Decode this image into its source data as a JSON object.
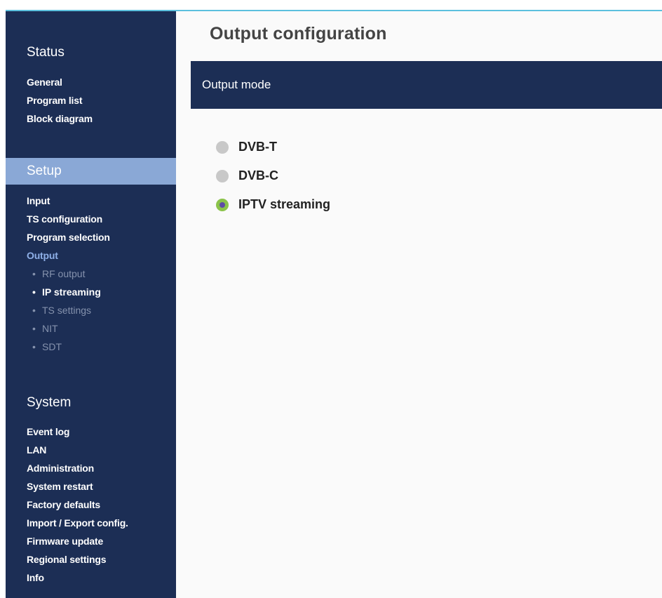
{
  "sidebar": {
    "status": {
      "title": "Status",
      "items": [
        "General",
        "Program list",
        "Block diagram"
      ]
    },
    "setup": {
      "title": "Setup",
      "items": [
        "Input",
        "TS configuration",
        "Program selection",
        "Output"
      ],
      "output_sub": [
        "RF output",
        "IP streaming",
        "TS settings",
        "NIT",
        "SDT"
      ]
    },
    "system": {
      "title": "System",
      "items": [
        "Event log",
        "LAN",
        "Administration",
        "System restart",
        "Factory defaults",
        "Import / Export config.",
        "Firmware update",
        "Regional settings",
        "Info"
      ]
    }
  },
  "main": {
    "title": "Output configuration",
    "section_title": "Output mode",
    "options": [
      {
        "label": "DVB-T",
        "checked": false
      },
      {
        "label": "DVB-C",
        "checked": false
      },
      {
        "label": "IPTV streaming",
        "checked": true
      }
    ]
  },
  "colors": {
    "nav_bg": "#1c2e55",
    "setup_header_bg": "#8aa8d6",
    "active_link": "#8fb0e8",
    "radio_checked_ring": "#8bc34a",
    "radio_checked_dot": "#5e4ba6",
    "radio_unchecked": "#c8c8c8"
  }
}
